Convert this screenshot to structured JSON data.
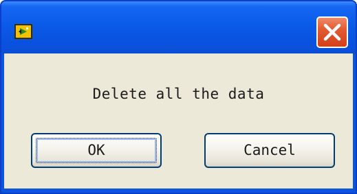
{
  "dialog": {
    "title": "",
    "icon": "labview-app-icon",
    "message": "Delete all the data",
    "ok_label": "OK",
    "cancel_label": "Cancel"
  },
  "titlebar": {
    "close_icon": "close-icon",
    "colors": {
      "titlebar": "#0a5be8",
      "close_button": "#e25a33",
      "client_background": "#ece9d8",
      "button_border": "#003c74"
    }
  }
}
